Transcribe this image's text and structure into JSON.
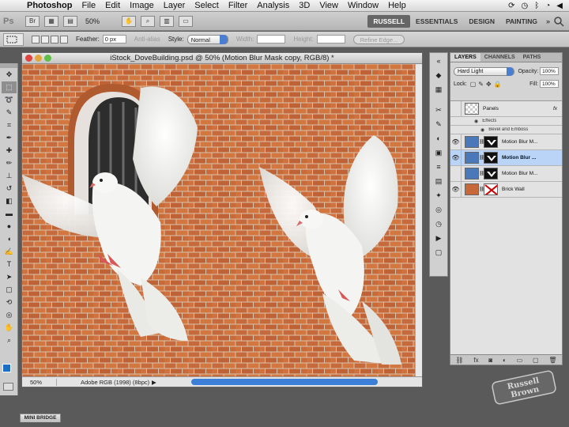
{
  "menubar": {
    "app": "Photoshop",
    "items": [
      "File",
      "Edit",
      "Image",
      "Layer",
      "Select",
      "Filter",
      "Analysis",
      "3D",
      "View",
      "Window",
      "Help"
    ]
  },
  "appbar": {
    "logo": "Ps",
    "zoom": "50%",
    "workspaces": [
      "RUSSELL",
      "ESSENTIALS",
      "DESIGN",
      "PAINTING"
    ],
    "more": "»"
  },
  "options": {
    "feather_label": "Feather:",
    "feather_value": "0 px",
    "anti_alias": "Anti-alias",
    "style_label": "Style:",
    "style_value": "Normal",
    "width_label": "Width:",
    "height_label": "Height:",
    "refine_edge": "Refine Edge..."
  },
  "document": {
    "title": "iStock_DoveBuilding.psd @ 50% (Motion Blur Mask copy, RGB/8) *",
    "zoom": "50%",
    "profile": "Adobe RGB (1998) (8bpc)"
  },
  "layers_panel": {
    "tabs": [
      "LAYERS",
      "CHANNELS",
      "PATHS"
    ],
    "blend_mode": "Hard Light",
    "opacity_label": "Opacity:",
    "opacity_value": "100%",
    "lock_label": "Lock:",
    "fill_label": "Fill:",
    "fill_value": "100%",
    "layers": [
      {
        "name": "Panels",
        "kind": "effects-layer"
      },
      {
        "name": "Effects",
        "kind": "sub"
      },
      {
        "name": "Bevel and Emboss",
        "kind": "sub"
      },
      {
        "name": "Motion Blur M...",
        "kind": "mask-layer",
        "visible": true
      },
      {
        "name": "Motion Blur ...",
        "kind": "mask-layer",
        "visible": true,
        "selected": true
      },
      {
        "name": "Motion Blur M...",
        "kind": "mask-layer",
        "visible": false
      },
      {
        "name": "Brick Wall",
        "kind": "image-layer",
        "visible": true
      }
    ]
  },
  "bottom_tabs": {
    "mini_bridge": "MINI BRIDGE"
  },
  "colors": {
    "foreground": "#1d6fc3",
    "background": "#ffffff",
    "brick": "#c6683a",
    "selection": "#b9d4f7"
  },
  "icons": {
    "tools": [
      "move-icon",
      "marquee-icon",
      "lasso-icon",
      "quick-select-icon",
      "crop-icon",
      "eyedropper-icon",
      "healing-icon",
      "brush-icon",
      "stamp-icon",
      "history-brush-icon",
      "eraser-icon",
      "gradient-icon",
      "blur-icon",
      "dodge-icon",
      "pen-icon",
      "type-icon",
      "path-select-icon",
      "shape-icon",
      "3d-rotate-icon",
      "3d-orbit-icon",
      "hand-icon",
      "zoom-icon"
    ]
  }
}
